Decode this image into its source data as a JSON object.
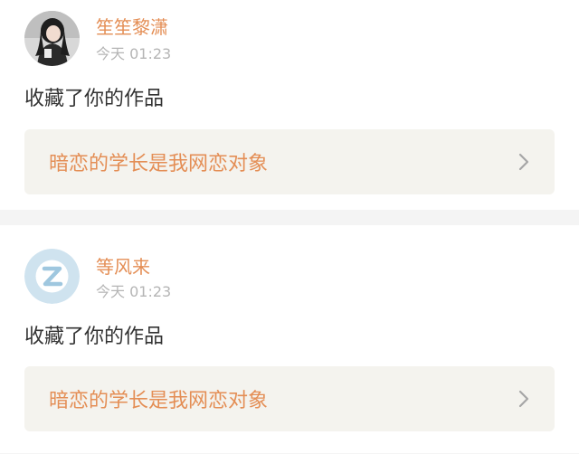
{
  "notifications": [
    {
      "username": "笙笙黎潇",
      "time": "今天 01:23",
      "action": "收藏了你的作品",
      "work_title": "暗恋的学长是我网恋对象",
      "avatar_icon": "user-photo-avatar"
    },
    {
      "username": "等风来",
      "time": "今天 01:23",
      "action": "收藏了你的作品",
      "work_title": "暗恋的学长是我网恋对象",
      "avatar_icon": "default-z-avatar"
    }
  ],
  "colors": {
    "accent": "#e48e55",
    "muted": "#b5b5b5",
    "link_bg": "#f4f3ee",
    "divider": "#f4f4f4"
  }
}
